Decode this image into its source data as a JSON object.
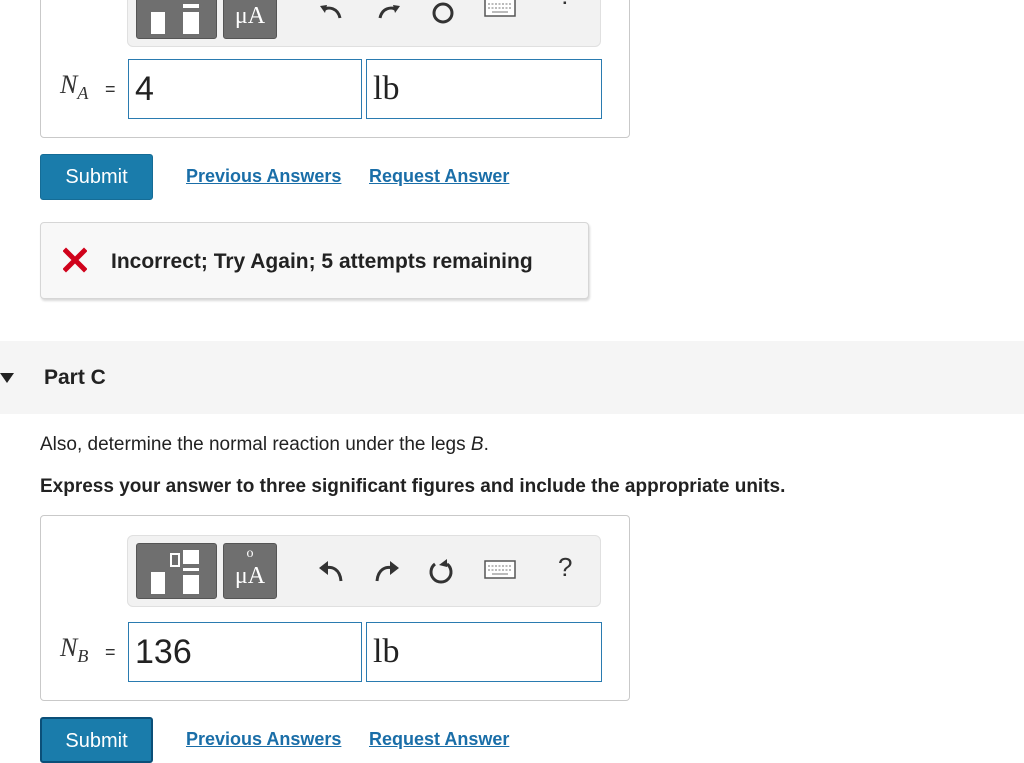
{
  "partB": {
    "toolbar": {
      "units_label": "μA",
      "help_label": "?"
    },
    "answer": {
      "label_main": "N",
      "label_sub": "A",
      "equals": "=",
      "value": "4",
      "unit": "lb"
    },
    "submit_label": "Submit",
    "previous_answers_label": "Previous Answers",
    "request_answer_label": "Request Answer",
    "feedback": {
      "message": "Incorrect; Try Again; 5 attempts remaining"
    }
  },
  "partC": {
    "title": "Part C",
    "question_prefix": "Also, determine the normal reaction under the legs ",
    "question_var": "B",
    "question_suffix": ".",
    "instruction": "Express your answer to three significant figures and include the appropriate units.",
    "toolbar": {
      "units_ring": "o",
      "units_label": "μA",
      "help_label": "?"
    },
    "answer": {
      "label_main": "N",
      "label_sub": "B",
      "equals": "=",
      "value": "136",
      "unit": "lb"
    },
    "submit_label": "Submit",
    "previous_answers_label": "Previous Answers",
    "request_answer_label": "Request Answer"
  },
  "colors": {
    "primary": "#1a7cab",
    "link": "#1a6ea8",
    "error": "#d0021b",
    "field_border": "#2a7bb0"
  }
}
